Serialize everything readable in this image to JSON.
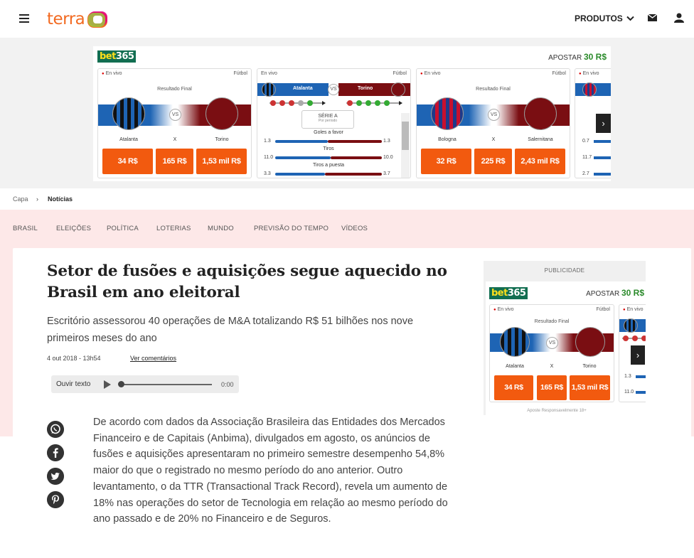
{
  "header": {
    "logo_text": "terra",
    "produtos_label": "PRODUTOS"
  },
  "ad": {
    "brand_a": "bet",
    "brand_b": "365",
    "apostar_label": "APOSTAR",
    "apostar_value": "30 R$",
    "live_label": "En vivo",
    "sport_label": "Fútbol",
    "result_label": "Resultado Final",
    "vs_label": "VS",
    "x_label": "X",
    "match1": {
      "home": "Atalanta",
      "away": "Torino",
      "odds": [
        "34 R$",
        "165 R$",
        "1,53 mil R$"
      ]
    },
    "match2": {
      "home": "Atalanta",
      "away": "Torino",
      "league": "SÉRIE A",
      "period": "Por período",
      "stats": [
        {
          "label": "Goles a favor",
          "home": "1.3",
          "away": "1.3"
        },
        {
          "label": "Tiros",
          "home": "11.0",
          "away": "10.0"
        },
        {
          "label": "Tiros a puesta",
          "home": "3.3",
          "away": "3.7"
        }
      ]
    },
    "match3": {
      "home": "Bologna",
      "away": "Salernitana",
      "odds": [
        "32 R$",
        "225 R$",
        "2,43 mil R$"
      ]
    },
    "partial_stats": [
      "0.7",
      "11.7",
      "2.7"
    ]
  },
  "breadcrumb": {
    "home": "Capa",
    "separator": "›",
    "current": "Notícias"
  },
  "nav": [
    "BRASIL",
    "ELEIÇÕES",
    "POLÍTICA",
    "LOTERIAS",
    "MUNDO",
    "PREVISÃO DO TEMPO",
    "VÍDEOS"
  ],
  "article": {
    "title": "Setor de fusões e aquisições segue aquecido no Brasil em ano eleitoral",
    "subtitle": "Escritório assessorou 40 operações de M&A totalizando R$ 51 bilhões nos nove primeiros meses do ano",
    "date": "4 out 2018 - 13h54",
    "comments_link": "Ver comentários",
    "audio_label": "Ouvir texto",
    "audio_time": "0:00",
    "body": "De acordo com dados da Associação Brasileira das Entidades dos Mercados Financeiro e de Capitais (Anbima), divulgados em agosto, os anúncios de fusões e aquisições apresentaram no primeiro semestre desempenho 54,8% maior do que o registrado no mesmo período do ano anterior. Outro levantamento, o da TTR (Transactional Track Record), revela um aumento de 18% nas operações do setor de Tecnologia em relação ao mesmo período do ano passado e de 20% no Financeiro e de Seguros."
  },
  "sidebar": {
    "publicidade_label": "PUBLICIDADE",
    "match": {
      "home": "Atalanta",
      "away": "Torino",
      "odds": [
        "34 R$",
        "165 R$",
        "1,53 mil R$"
      ]
    },
    "partial_stats": [
      "1.3",
      "11.0"
    ],
    "responsible": "Aposte Responsavelmente 18+"
  },
  "colors": {
    "accent": "#f26a21",
    "odds": "#f25a0f",
    "atalanta": "#1e64b4",
    "torino": "#7a0e12",
    "pink": "#fde8e8"
  }
}
